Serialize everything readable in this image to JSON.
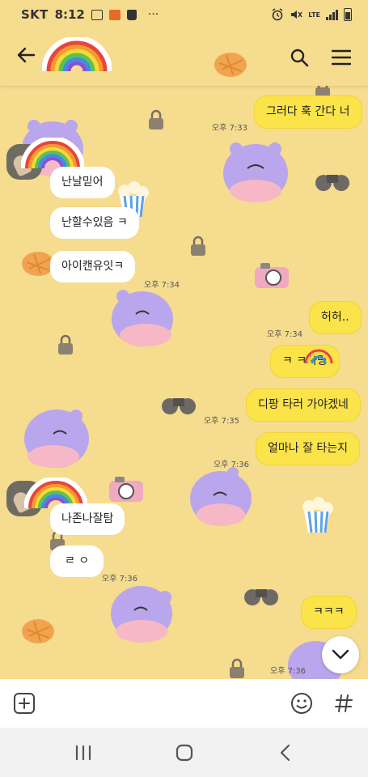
{
  "status_bar": {
    "carrier": "SKT",
    "time": "8:12",
    "dots": "···",
    "network": "LTE"
  },
  "header": {
    "back_icon": "back-arrow-icon",
    "search_icon": "search-icon",
    "menu_icon": "menu-icon"
  },
  "messages": [
    {
      "side": "me",
      "text": "그러다 훅 간다 너"
    },
    {
      "time": "오후 7:33"
    },
    {
      "side": "other",
      "text": "난날믿어"
    },
    {
      "side": "other",
      "text": "난할수있음 ㅋ"
    },
    {
      "side": "other",
      "text": "아이캔유잇ㅋ"
    },
    {
      "time": "오후 7:34"
    },
    {
      "side": "me",
      "text": "허허.."
    },
    {
      "time": "오후 7:34"
    },
    {
      "side": "me",
      "text": "ㅋ ㅋ사랑"
    },
    {
      "side": "me",
      "text": "디팡 타러 가야겠네"
    },
    {
      "time": "오후 7:35"
    },
    {
      "side": "me",
      "text": "얼마나 잘 타는지"
    },
    {
      "time": "오후 7:36"
    },
    {
      "side": "other",
      "text": "나존나잘탐"
    },
    {
      "side": "other",
      "text": "ㄹ ㅇ"
    },
    {
      "time": "오후 7:36"
    },
    {
      "side": "me",
      "text": "ㅋㅋㅋ"
    },
    {
      "time": "오후 7:36"
    }
  ],
  "colors": {
    "background": "#f5dc8e",
    "my_bubble": "#fbe34a",
    "other_bubble": "#ffffff"
  }
}
